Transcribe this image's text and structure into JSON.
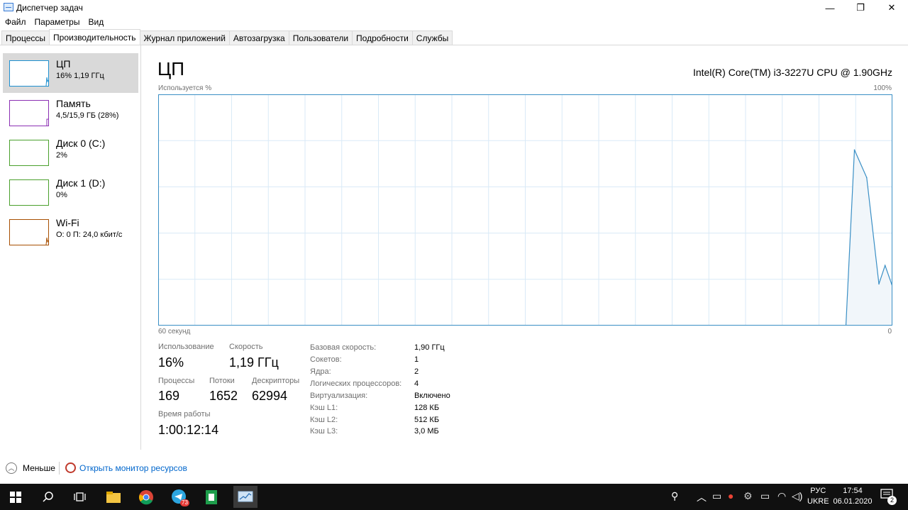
{
  "window": {
    "title": "Диспетчер задач",
    "minimize": "—",
    "maximize": "❐",
    "close": "✕"
  },
  "menu": [
    "Файл",
    "Параметры",
    "Вид"
  ],
  "tabs": [
    {
      "label": "Процессы",
      "active": false
    },
    {
      "label": "Производительность",
      "active": true
    },
    {
      "label": "Журнал приложений",
      "active": false
    },
    {
      "label": "Автозагрузка",
      "active": false
    },
    {
      "label": "Пользователи",
      "active": false
    },
    {
      "label": "Подробности",
      "active": false
    },
    {
      "label": "Службы",
      "active": false
    }
  ],
  "sidebar": [
    {
      "name": "ЦП",
      "sub": "16%  1,19 ГГц",
      "color": "#1e90d0"
    },
    {
      "name": "Память",
      "sub": "4,5/15,9 ГБ (28%)",
      "color": "#8b2fb3"
    },
    {
      "name": "Диск 0 (C:)",
      "sub": "2%",
      "color": "#4aa02c"
    },
    {
      "name": "Диск 1 (D:)",
      "sub": "0%",
      "color": "#4aa02c"
    },
    {
      "name": "Wi-Fi",
      "sub": "О: 0 П: 24,0 кбит/с",
      "color": "#a74f01"
    }
  ],
  "main": {
    "title": "ЦП",
    "cpu_model": "Intel(R) Core(TM) i3-3227U CPU @ 1.90GHz",
    "axis_top_left": "Используется %",
    "axis_top_right": "100%",
    "axis_bottom_left": "60 секунд",
    "axis_bottom_right": "0"
  },
  "chart_data": {
    "type": "area",
    "ylim": [
      0,
      100
    ],
    "xlim": [
      60,
      0
    ],
    "grid": true,
    "series": [
      {
        "x": [
          60,
          3.1,
          2.1,
          1.1,
          0.6,
          0
        ],
        "values": [
          0,
          76,
          64,
          18,
          26,
          17
        ]
      }
    ]
  },
  "stats": {
    "usage_label": "Использование",
    "usage_value": "16%",
    "speed_label": "Скорость",
    "speed_value": "1,19 ГГц",
    "processes_label": "Процессы",
    "processes_value": "169",
    "threads_label": "Потоки",
    "threads_value": "1652",
    "handles_label": "Дескрипторы",
    "handles_value": "62994",
    "uptime_label": "Время работы",
    "uptime_value": "1:00:12:14"
  },
  "details": [
    {
      "label": "Базовая скорость:",
      "value": "1,90 ГГц"
    },
    {
      "label": "Сокетов:",
      "value": "1"
    },
    {
      "label": "Ядра:",
      "value": "2"
    },
    {
      "label": "Логических процессоров:",
      "value": "4"
    },
    {
      "label": "Виртуализация:",
      "value": "Включено"
    },
    {
      "label": "Кэш L1:",
      "value": "128 КБ"
    },
    {
      "label": "Кэш L2:",
      "value": "512 КБ"
    },
    {
      "label": "Кэш L3:",
      "value": "3,0 МБ"
    }
  ],
  "footer": {
    "fewer": "Меньше",
    "monitor": "Открыть монитор ресурсов"
  },
  "taskbar": {
    "telegram_badge": "73",
    "lang_top": "РУС",
    "lang_bottom": "UKRE",
    "time": "17:54",
    "date": "06.01.2020",
    "notification_count": "2"
  }
}
